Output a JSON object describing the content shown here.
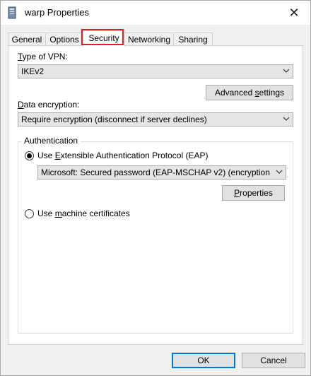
{
  "window": {
    "title": "warp Properties",
    "close_glyph": "✕"
  },
  "tabs": [
    {
      "label": "General"
    },
    {
      "label": "Options"
    },
    {
      "label": "Security"
    },
    {
      "label": "Networking"
    },
    {
      "label": "Sharing"
    }
  ],
  "active_tab": "Security",
  "highlight_color": "#e02020",
  "vpn_type": {
    "label_prefix": "T",
    "label_rest": "ype of VPN:",
    "value": "IKEv2"
  },
  "advanced_settings": {
    "label_prefix": "Advanced ",
    "label_ul": "s",
    "label_rest": "ettings"
  },
  "data_encryption": {
    "label_prefix": "D",
    "label_rest": "ata encryption:",
    "value": "Require encryption (disconnect if server declines)"
  },
  "authentication": {
    "group_title": "Authentication",
    "eap_option": {
      "label_prefix": "Use ",
      "label_ul": "E",
      "label_rest": "xtensible Authentication Protocol (EAP)",
      "selected": true
    },
    "eap_method": "Microsoft: Secured password (EAP-MSCHAP v2) (encryption",
    "properties_button": {
      "label_prefix": "P",
      "label_ul": "r",
      "label_rest": "operties"
    },
    "machine_cert_option": {
      "label_prefix": "Use ",
      "label_ul": "m",
      "label_rest": "achine certificates",
      "selected": false
    }
  },
  "footer": {
    "ok_label": "OK",
    "cancel_label": "Cancel"
  },
  "icons": {
    "window_icon": "vpn-connection-icon",
    "dropdown_arrow": "chevron-down-icon",
    "close": "close-icon"
  }
}
